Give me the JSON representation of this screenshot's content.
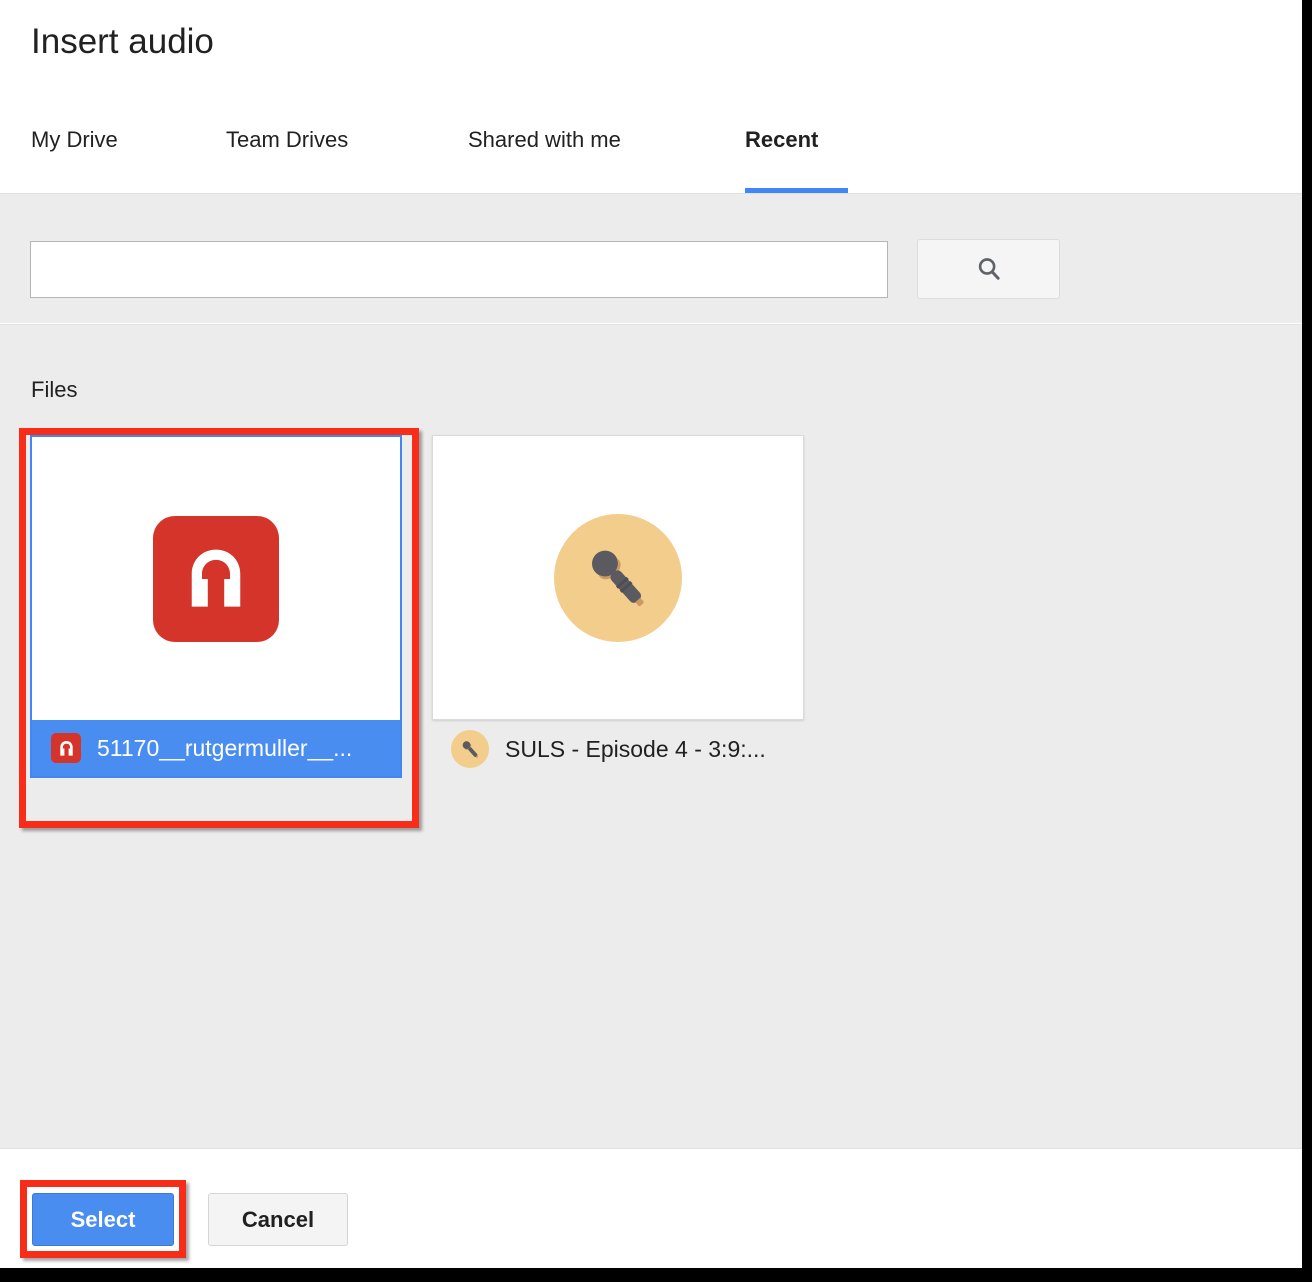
{
  "dialog": {
    "title": "Insert audio"
  },
  "tabs": [
    {
      "label": "My Drive",
      "active": false
    },
    {
      "label": "Team Drives",
      "active": false
    },
    {
      "label": "Shared with me",
      "active": false
    },
    {
      "label": "Recent",
      "active": true
    }
  ],
  "search": {
    "value": "",
    "placeholder": "",
    "button_icon": "search-icon"
  },
  "files_section": {
    "heading": "Files",
    "items": [
      {
        "name": "51170__rutgermuller__...",
        "icon": "headphones-icon",
        "selected": true,
        "thumb_icon": "headphones-icon"
      },
      {
        "name": "SULS - Episode 4 - 3:9:...",
        "icon": "microphone-icon",
        "selected": false,
        "thumb_icon": "microphone-icon"
      }
    ]
  },
  "footer": {
    "select_label": "Select",
    "cancel_label": "Cancel"
  },
  "colors": {
    "accent_blue": "#4285f4",
    "selection_blue": "#4a8df0",
    "annotation_red": "#f72c19",
    "audio_icon_red": "#d5342a",
    "mic_circle_tan": "#f3cd8c",
    "mic_body_gray": "#5a5a60",
    "panel_gray": "#ececec"
  },
  "annotations": [
    {
      "target": "first-file-card"
    },
    {
      "target": "select-button"
    }
  ]
}
